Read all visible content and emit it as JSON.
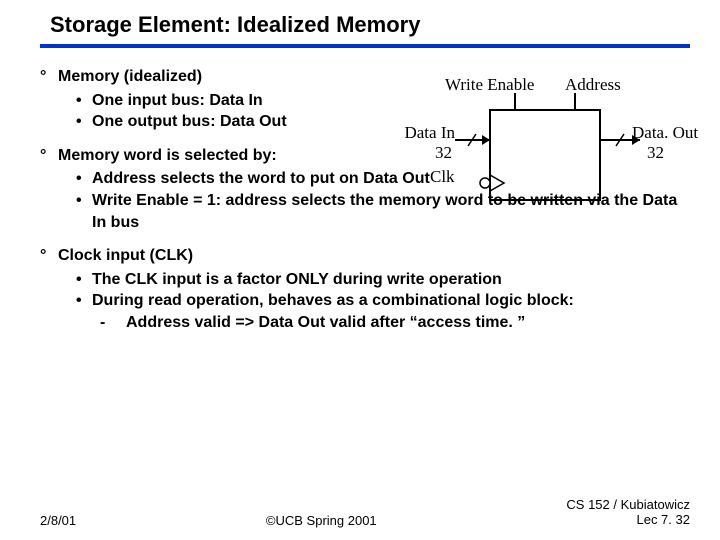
{
  "title": "Storage Element: Idealized Memory",
  "bullets": {
    "b1": "Memory (idealized)",
    "b1a": "One input bus: Data In",
    "b1b": "One output bus: Data Out",
    "b2": "Memory word is selected by:",
    "b2a": "Address selects the word to put on Data Out",
    "b2b": "Write Enable = 1: address selects the memory word to be written via the Data In bus",
    "b3": "Clock input (CLK)",
    "b3a": "The CLK input is a factor ONLY during write operation",
    "b3b": "During read operation, behaves  as a combinational logic block:",
    "b3b1": "Address valid => Data Out valid after “access time. ”"
  },
  "diagram": {
    "write_enable": "Write Enable",
    "address": "Address",
    "data_in": "Data In",
    "data_in_bits": "32",
    "clk": "Clk",
    "data_out": "Data. Out",
    "data_out_bits": "32"
  },
  "footer": {
    "date": "2/8/01",
    "center": "©UCB Spring 2001",
    "right1": "CS 152 / Kubiatowicz",
    "right2": "Lec 7. 32"
  }
}
